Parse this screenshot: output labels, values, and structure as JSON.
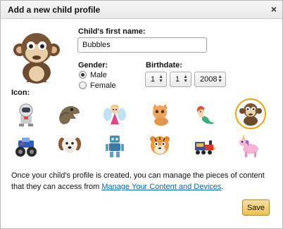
{
  "dialog": {
    "title": "Add a new child profile",
    "close_glyph": "×"
  },
  "form": {
    "name_label": "Child's first name:",
    "name_value": "Bubbles",
    "gender_label": "Gender:",
    "gender_options": [
      {
        "label": "Male",
        "selected": true
      },
      {
        "label": "Female",
        "selected": false
      }
    ],
    "birthdate_label": "Birthdate:",
    "month_value": "1",
    "day_value": "1",
    "year_value": "2008",
    "icon_label": "Icon:"
  },
  "icons": [
    {
      "name": "astronaut-icon",
      "selected": false
    },
    {
      "name": "dinosaur-icon",
      "selected": false
    },
    {
      "name": "fairy-icon",
      "selected": false
    },
    {
      "name": "kitten-icon",
      "selected": false
    },
    {
      "name": "mermaid-icon",
      "selected": false
    },
    {
      "name": "monkey-icon",
      "selected": true
    },
    {
      "name": "monster-truck-icon",
      "selected": false
    },
    {
      "name": "puppy-icon",
      "selected": false
    },
    {
      "name": "robot-icon",
      "selected": false
    },
    {
      "name": "tiger-icon",
      "selected": false
    },
    {
      "name": "train-icon",
      "selected": false
    },
    {
      "name": "unicorn-icon",
      "selected": false
    }
  ],
  "info": {
    "text": "Once your child's profile is created, you can manage the pieces of content that they can access from ",
    "link": "Manage Your Content and Devices",
    "suffix": "."
  },
  "buttons": {
    "save_label": "Save"
  },
  "colors": {
    "accent_selected": "#f0a30a",
    "link": "#0066c0",
    "save_button": "#f0c14b"
  }
}
